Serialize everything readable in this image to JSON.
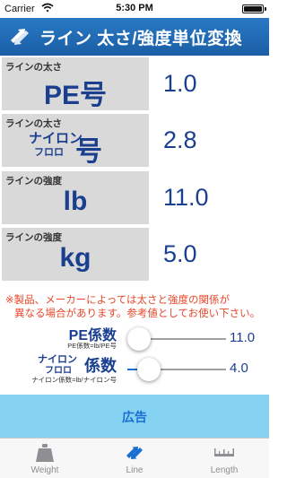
{
  "status_bar": {
    "carrier": "Carrier",
    "time": "5:30 PM"
  },
  "header": {
    "title": "ライン 太さ/強度単位変換",
    "icon": "swap-arrows-icon"
  },
  "rows": [
    {
      "caption": "ラインの太さ",
      "unit": "PE号",
      "value": "1.0"
    },
    {
      "caption": "ラインの太さ",
      "unit_line1": "ナイロン",
      "unit_line2": "フロロ",
      "unit_big": "号",
      "value": "2.8"
    },
    {
      "caption": "ラインの強度",
      "unit": "lb",
      "value": "11.0"
    },
    {
      "caption": "ラインの強度",
      "unit": "kg",
      "value": "5.0"
    }
  ],
  "note": {
    "line1": "※製品、メーカーによっては太さと強度の関係が",
    "line2": "異なる場合があります。参考値としてお使い下さい。"
  },
  "sliders": [
    {
      "title": "PE係数",
      "sub": "PE係数=lb/PE号",
      "value": "11.0",
      "level": 0.12
    },
    {
      "title_line1": "ナイロン",
      "title_line2": "フロロ",
      "title_big": "係数",
      "sub": "ナイロン係数=lb/ナイロン号",
      "value": "4.0",
      "level": 0.22
    }
  ],
  "ad": {
    "label": "広告"
  },
  "tabs": [
    {
      "label": "Weight",
      "icon": "weight-icon",
      "active": false
    },
    {
      "label": "Line",
      "icon": "swap-arrows-icon",
      "active": true
    },
    {
      "label": "Length",
      "icon": "ruler-icon",
      "active": false
    }
  ],
  "colors": {
    "header": "#1f6ab4",
    "value_text": "#1b3f8f",
    "note": "#e8472b",
    "ad": "#86d2f2",
    "active_tab": "#1b6fd0"
  }
}
